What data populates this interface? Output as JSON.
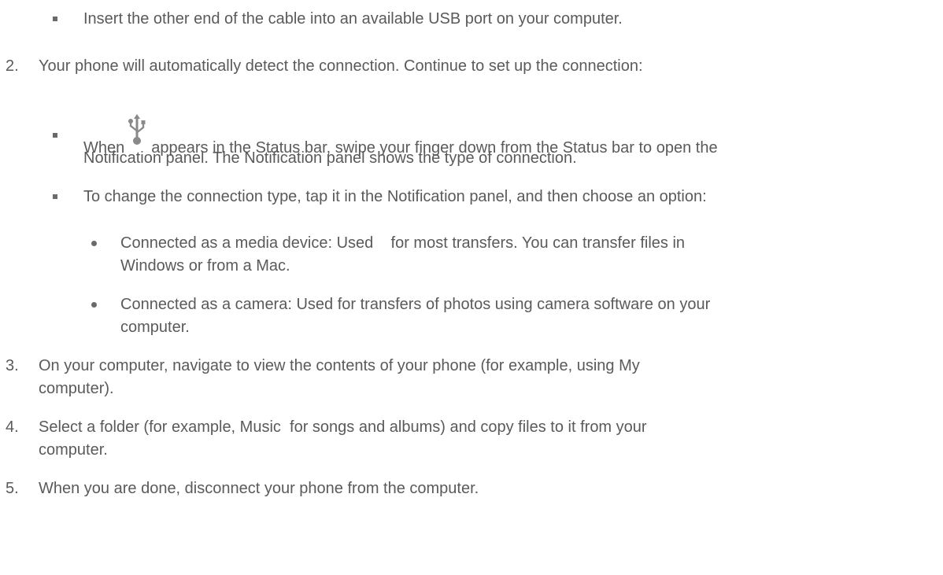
{
  "doc": {
    "item1_sub": "Insert the other end of the cable into an available USB port on your computer.",
    "step2": {
      "num": "2.",
      "text": "Your phone will automatically detect the connection. Continue to set up the connection:"
    },
    "step2_sub1": {
      "before": "When",
      "after_line1": "appears in the Status bar, swipe your finger down from the Status bar to open the",
      "line2": "Notification panel. The Notification panel shows the type of connection."
    },
    "step2_sub2": "To change the connection type, tap it in the Notification panel, and then choose an option:",
    "option1": {
      "line1": "Connected as a media device: Used    for most transfers. You can transfer files in",
      "line2": "Windows or from a Mac."
    },
    "option2": {
      "line1": "Connected as a camera: Used for transfers of photos using camera software on your",
      "line2": "computer."
    },
    "step3": {
      "num": "3.",
      "line1": "On your computer, navigate to view the contents of your phone (for example, using My",
      "line2": "computer)."
    },
    "step4": {
      "num": "4.",
      "line1": "Select a folder (for example, Music  for songs and albums) and copy files to it from your",
      "line2": "computer."
    },
    "step5": {
      "num": "5.",
      "text": "When you are done, disconnect your phone from the computer."
    },
    "icon": "usb-icon"
  }
}
